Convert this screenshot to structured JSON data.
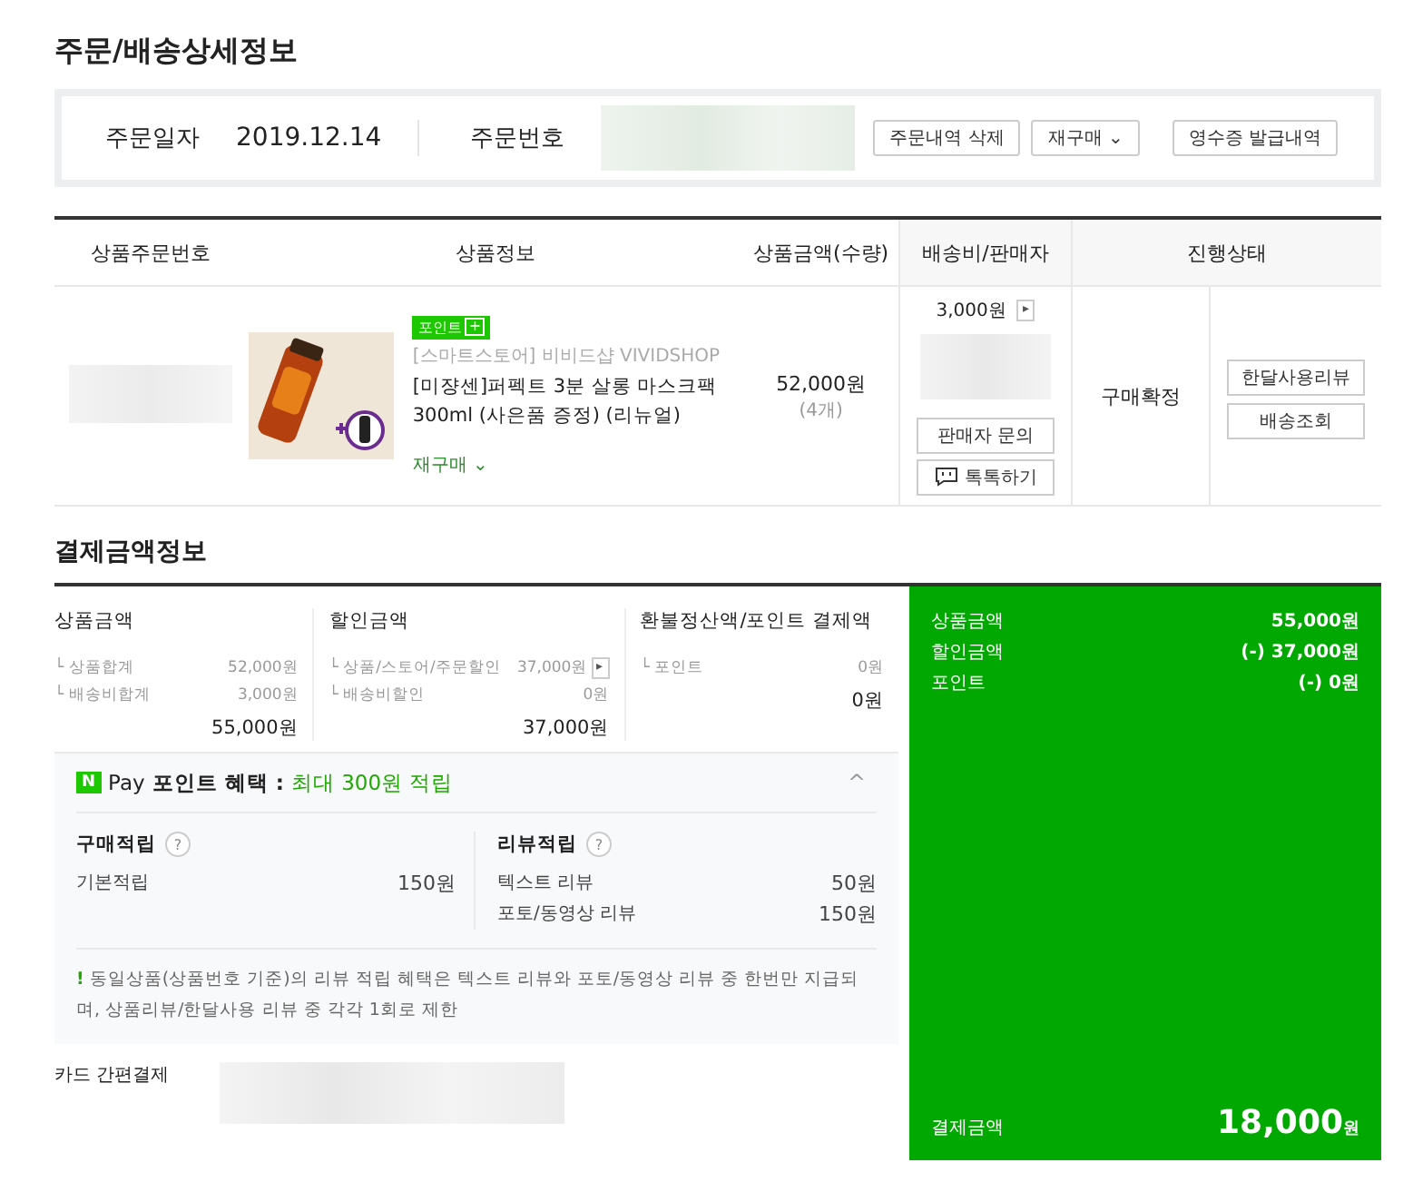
{
  "title": "주문/배송상세정보",
  "order": {
    "date_label": "주문일자",
    "date": "2019.12.14",
    "number_label": "주문번호",
    "buttons": [
      "주문내역 삭제",
      "재구매 ⌄"
    ],
    "receipt_button": "영수증 발급내역"
  },
  "table": {
    "columns": [
      "상품주문번호",
      "상품정보",
      "상품금액(수량)",
      "배송비/판매자",
      "진행상태"
    ],
    "rows": [
      {
        "badge": "포인트",
        "badge_icon": "+",
        "store": "[스마트스토어] 비비드샵 VIVIDSHOP",
        "name": "[미쟝센]퍼펙트 3분 살롱 마스크팩 300ml (사은품 증정) (리뉴얼)",
        "rebuy": "재구매 ⌄",
        "price": "52,000원",
        "qty": "(4개)",
        "shipping": "3,000원",
        "shipping_arrow": "▸",
        "seller_buttons": [
          {
            "label": "판매자 문의",
            "kind": "plain"
          },
          {
            "label": "톡톡하기",
            "kind": "talk"
          }
        ],
        "status": "구매확정",
        "actions": [
          "한달사용리뷰",
          "배송조회"
        ]
      }
    ]
  },
  "payment": {
    "title": "결제금액정보",
    "columns": [
      {
        "heading": "상품금액",
        "lines": [
          {
            "label": "└ 상품합계",
            "value": "52,000원",
            "arrow": false
          },
          {
            "label": "└ 배송비합계",
            "value": "3,000원",
            "arrow": false
          }
        ],
        "total": "55,000원"
      },
      {
        "heading": "할인금액",
        "lines": [
          {
            "label": "└ 상품/스토어/주문할인",
            "value": "37,000원",
            "arrow": true
          },
          {
            "label": "└ 배송비할인",
            "value": "0원",
            "arrow": false
          }
        ],
        "total": "37,000원"
      },
      {
        "heading": "환불정산액/포인트 결제액",
        "lines": [
          {
            "label": "└ 포인트",
            "value": "0원",
            "arrow": false
          }
        ],
        "total": "0원"
      }
    ],
    "arrow_glyph": "▸",
    "npay": {
      "logo": "N",
      "brand": "Pay",
      "title": "포인트 혜택 :",
      "highlight": "최대 300원 적립",
      "expanded": true,
      "collapse_glyph": "^",
      "groups": [
        {
          "heading": "구매적립",
          "help": "?",
          "lines": [
            {
              "label": "기본적립",
              "value": "150원"
            }
          ]
        },
        {
          "heading": "리뷰적립",
          "help": "?",
          "lines": [
            {
              "label": "텍스트 리뷰",
              "value": "50원"
            },
            {
              "label": "포토/동영상 리뷰",
              "value": "150원"
            }
          ]
        }
      ],
      "notice_mark": "!",
      "notice": "동일상품(상품번호 기준)의 리뷰 적립 혜택은 텍스트 리뷰와 포토/동영상 리뷰 중 한번만 지급되며, 상품리뷰/한달사용 리뷰 중 각각 1회로 제한"
    },
    "method_label": "카드 간편결제",
    "summary": [
      {
        "label": "상품금액",
        "value": "55,000원"
      },
      {
        "label": "할인금액",
        "value": "(-) 37,000원"
      },
      {
        "label": "포인트",
        "value": "(-) 0원"
      }
    ],
    "total_label": "결제금액",
    "total_value": "18,000",
    "total_unit": "원"
  }
}
